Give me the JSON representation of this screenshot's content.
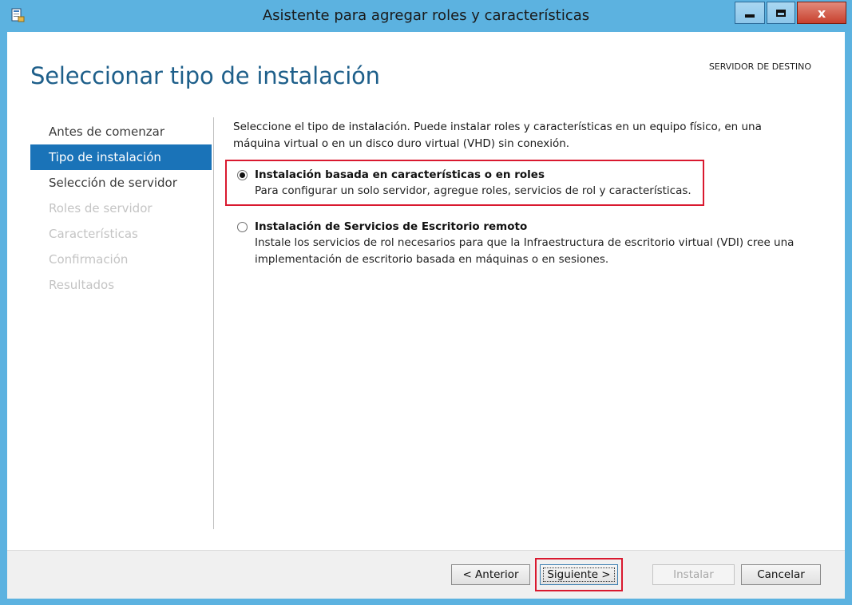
{
  "window": {
    "title": "Asistente para agregar roles y características",
    "close_glyph": "x"
  },
  "header": {
    "page_title": "Seleccionar tipo de instalación",
    "destination_label": "SERVIDOR DE DESTINO"
  },
  "nav": {
    "items": [
      {
        "label": "Antes de comenzar",
        "state": "normal"
      },
      {
        "label": "Tipo de instalación",
        "state": "active"
      },
      {
        "label": "Selección de servidor",
        "state": "normal"
      },
      {
        "label": "Roles de servidor",
        "state": "disabled"
      },
      {
        "label": "Características",
        "state": "disabled"
      },
      {
        "label": "Confirmación",
        "state": "disabled"
      },
      {
        "label": "Resultados",
        "state": "disabled"
      }
    ]
  },
  "main": {
    "intro": "Seleccione el tipo de instalación. Puede instalar roles y características en un equipo físico, en una máquina virtual o en un disco duro virtual (VHD) sin conexión.",
    "options": [
      {
        "label": "Instalación basada en características o en roles",
        "description": "Para configurar un solo servidor, agregue roles, servicios de rol y características.",
        "selected": true
      },
      {
        "label": "Instalación de Servicios de Escritorio remoto",
        "description": "Instale los servicios de rol necesarios para que la Infraestructura de escritorio virtual (VDI) cree una implementación de escritorio basada en máquinas o en sesiones.",
        "selected": false
      }
    ]
  },
  "footer": {
    "previous_label": "< Anterior",
    "next_label": "Siguiente >",
    "install_label": "Instalar",
    "cancel_label": "Cancelar"
  },
  "colors": {
    "frame": "#5cb2e0",
    "accent": "#1a73b8",
    "title_text": "#1e5f8a",
    "highlight": "#d9192f"
  },
  "icons": {
    "app": "server-wizard-icon",
    "minimize": "minimize-icon",
    "maximize": "maximize-icon",
    "close": "close-icon"
  }
}
